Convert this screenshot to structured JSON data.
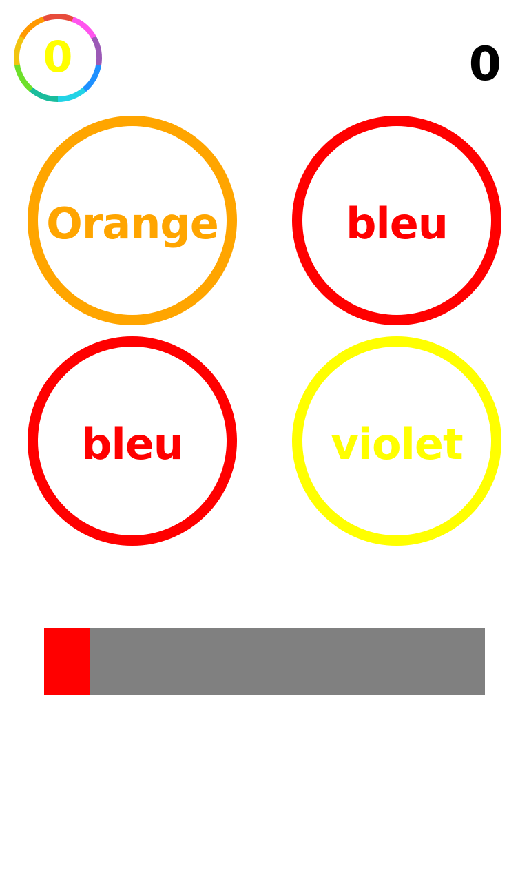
{
  "badge": {
    "value": "0",
    "value_color": "#ffff00",
    "ring_colors": [
      "#ff55ee",
      "#9b59b6",
      "#1e90ff",
      "#22d3e6",
      "#1abc9c",
      "#6ee02a",
      "#f1c40f",
      "#ff9900",
      "#e74c3c"
    ]
  },
  "score": "0",
  "circles": [
    {
      "label": "Orange",
      "text_color": "#ffa500",
      "ring_color": "#ffa500"
    },
    {
      "label": "bleu",
      "text_color": "#ff0000",
      "ring_color": "#ff0000"
    },
    {
      "label": "bleu",
      "text_color": "#ff0000",
      "ring_color": "#ff0000"
    },
    {
      "label": "violet",
      "text_color": "#ffff00",
      "ring_color": "#ffff00"
    }
  ],
  "timer": {
    "progress": 0.105,
    "fill_color": "#ff0000",
    "track_color": "#808080"
  }
}
